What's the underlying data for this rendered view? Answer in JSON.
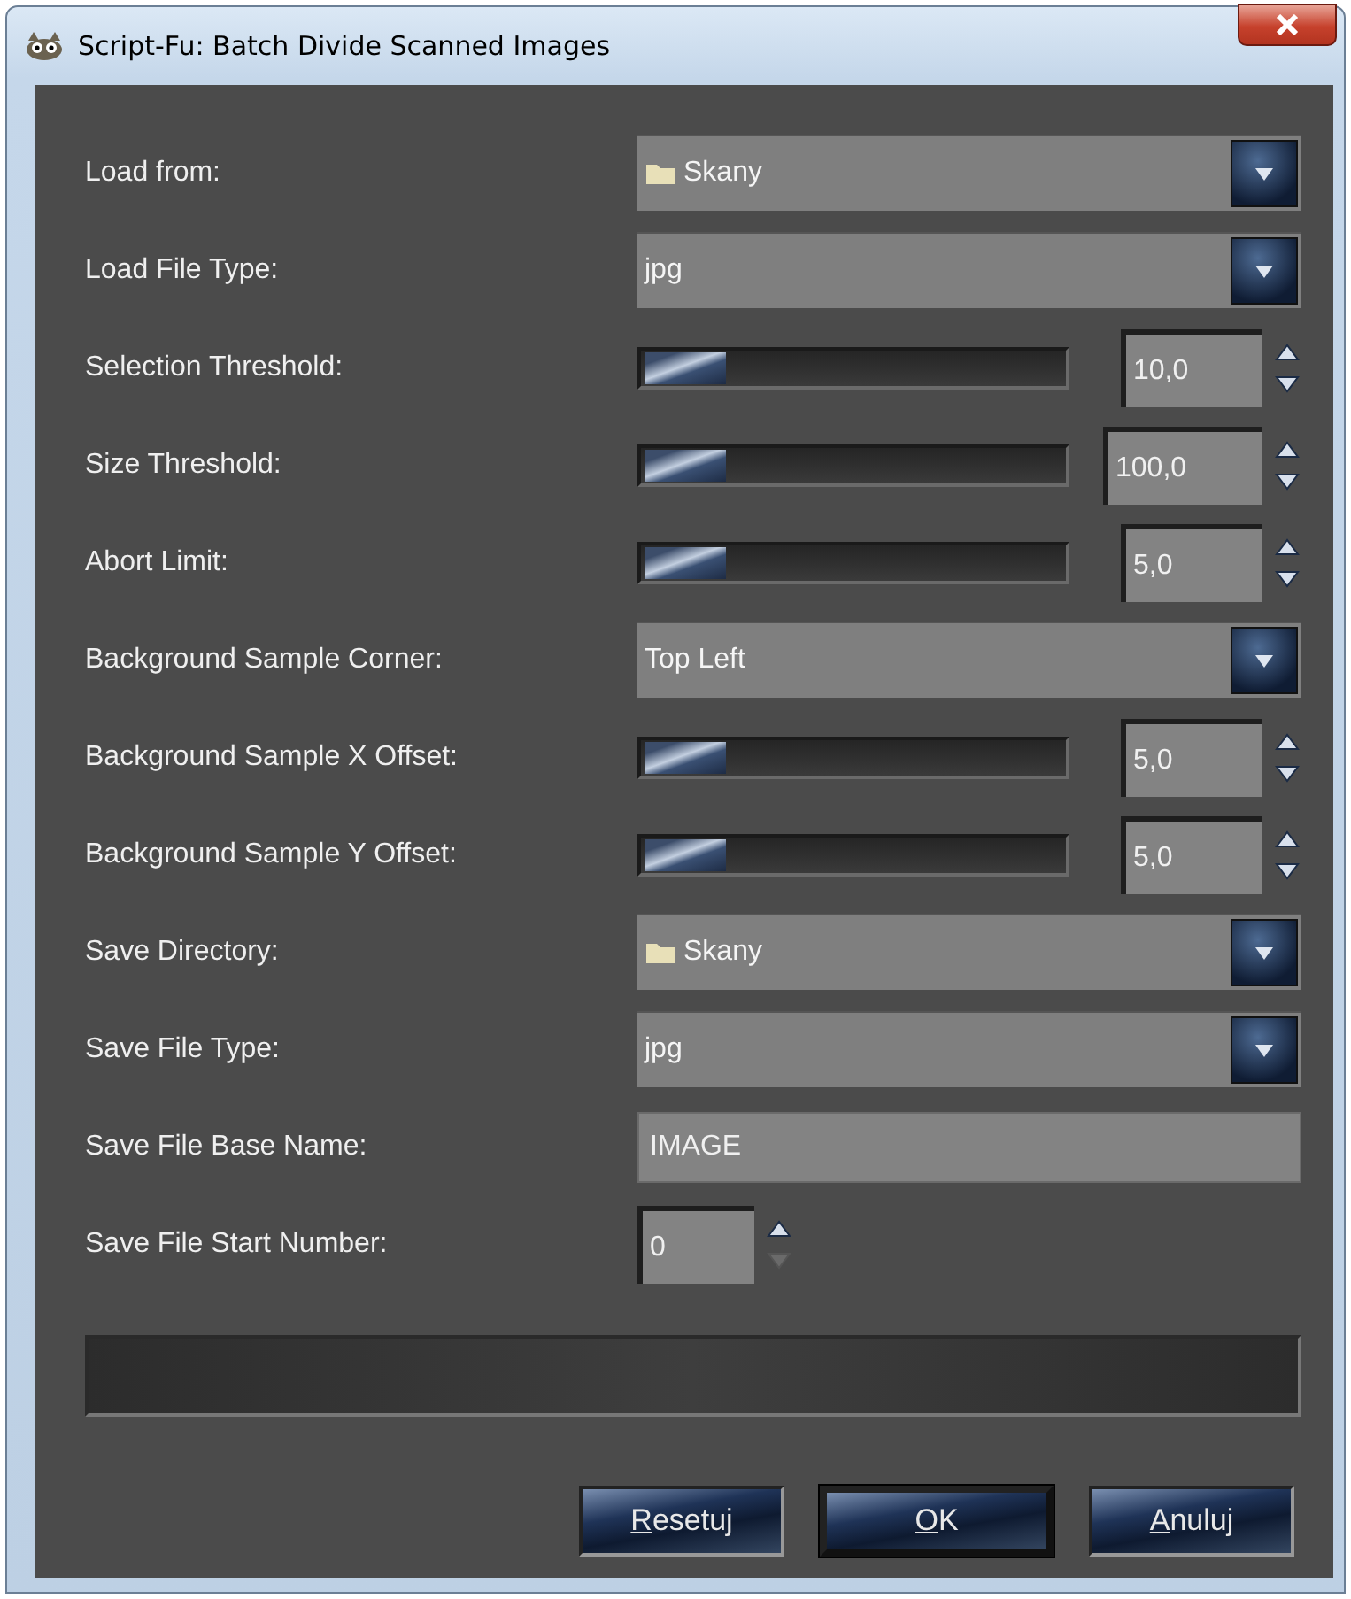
{
  "window": {
    "title": "Script-Fu: Batch Divide Scanned Images"
  },
  "fields": [
    {
      "kind": "folder",
      "label": "Load from:",
      "value": "Skany"
    },
    {
      "kind": "combo",
      "label": "Load File Type:",
      "value": "jpg"
    },
    {
      "kind": "slider",
      "label": "Selection Threshold:",
      "level": 0.0,
      "value": "10,0",
      "down_enabled": true
    },
    {
      "kind": "slider",
      "label": "Size Threshold:",
      "level": 0.0,
      "value": "100,0",
      "down_enabled": true
    },
    {
      "kind": "slider",
      "label": "Abort Limit:",
      "level": 0.0,
      "value": "5,0",
      "down_enabled": true
    },
    {
      "kind": "combo",
      "label": "Background Sample Corner:",
      "value": "Top Left"
    },
    {
      "kind": "slider",
      "label": "Background Sample X Offset:",
      "level": 0.0,
      "value": "5,0",
      "down_enabled": true
    },
    {
      "kind": "slider",
      "label": "Background Sample Y Offset:",
      "level": 0.0,
      "value": "5,0",
      "down_enabled": true
    },
    {
      "kind": "folder",
      "label": "Save Directory:",
      "value": "Skany"
    },
    {
      "kind": "combo",
      "label": "Save File Type:",
      "value": "jpg"
    },
    {
      "kind": "text",
      "label": "Save File Base Name:",
      "value": "IMAGE"
    },
    {
      "kind": "spin",
      "label": "Save File Start Number:",
      "value": "0",
      "down_enabled": false
    }
  ],
  "progress": {
    "level": 0.0
  },
  "buttons": [
    {
      "mnemonic": "R",
      "rest": "esetuj",
      "default": false
    },
    {
      "mnemonic": "O",
      "rest": "K",
      "default": true
    },
    {
      "mnemonic": "A",
      "rest": "nuluj",
      "default": false
    }
  ]
}
